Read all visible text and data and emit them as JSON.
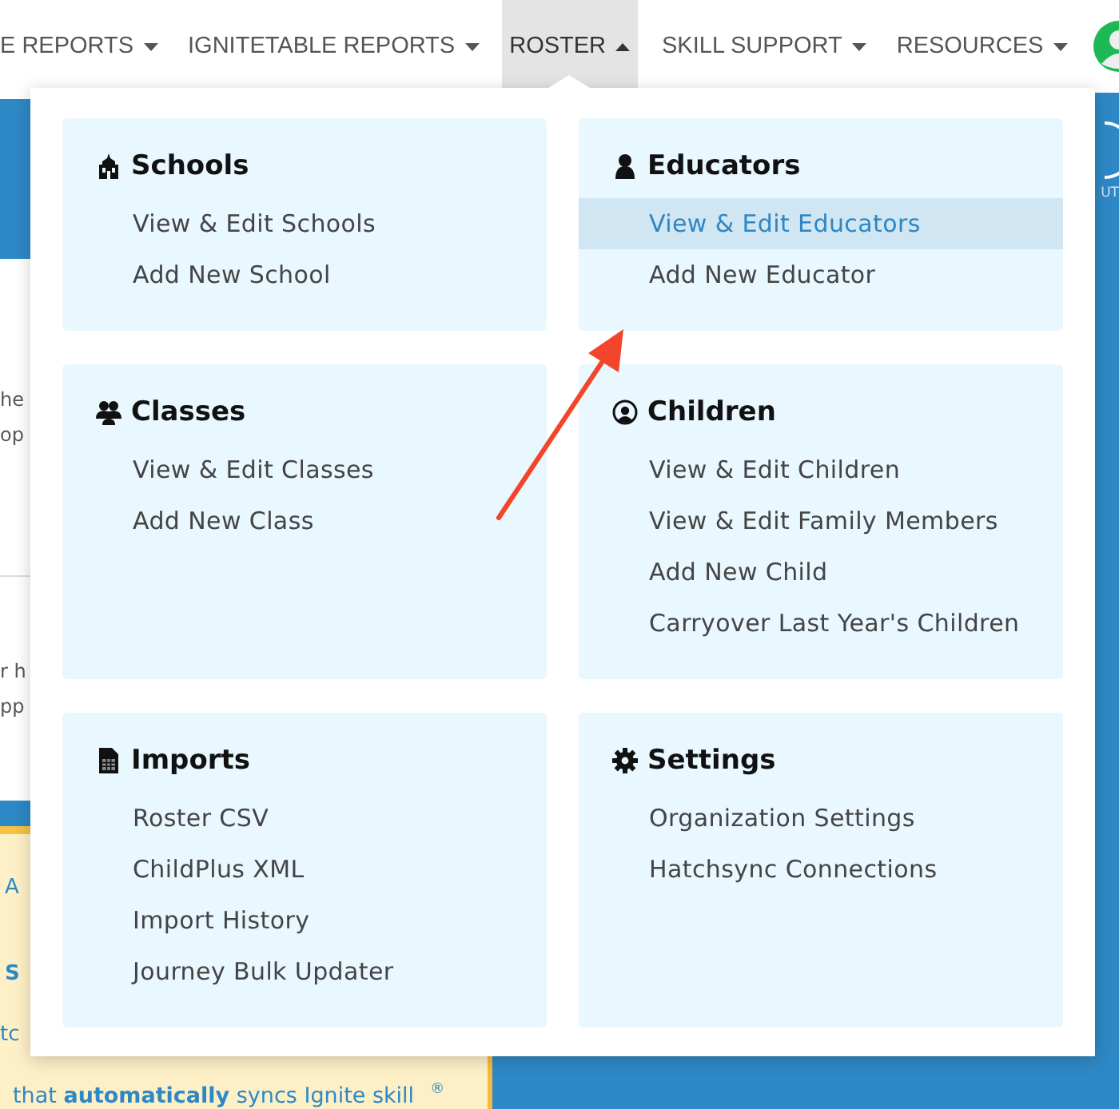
{
  "nav": {
    "items": [
      {
        "label": "E REPORTS",
        "selected": false
      },
      {
        "label": "IGNITETABLE REPORTS",
        "selected": false
      },
      {
        "label": "ROSTER",
        "selected": true
      },
      {
        "label": "SKILL SUPPORT",
        "selected": false
      },
      {
        "label": "RESOURCES",
        "selected": false
      }
    ]
  },
  "page": {
    "upper_fragments": [
      "he",
      "op"
    ],
    "lower_fragments": [
      "r h",
      "pp"
    ],
    "notice_fragments": [
      "A",
      "S",
      "tc"
    ],
    "notice_line": "that **automatically** syncs Ignite skill",
    "notice_mark": "®",
    "side_label": "UT"
  },
  "dropdown": {
    "sections": [
      {
        "title": "Schools",
        "kind": "school",
        "items": [
          {
            "label": "View & Edit Schools",
            "selected": false
          },
          {
            "label": "Add New School",
            "selected": false
          }
        ]
      },
      {
        "title": "Educators",
        "kind": "person",
        "items": [
          {
            "label": "View & Edit Educators",
            "selected": true
          },
          {
            "label": "Add New Educator",
            "selected": false
          }
        ]
      },
      {
        "title": "Classes",
        "kind": "group",
        "items": [
          {
            "label": "View & Edit Classes",
            "selected": false
          },
          {
            "label": "Add New Class",
            "selected": false
          }
        ]
      },
      {
        "title": "Children",
        "kind": "child",
        "items": [
          {
            "label": "View & Edit Children",
            "selected": false
          },
          {
            "label": "View & Edit Family Members",
            "selected": false
          },
          {
            "label": "Add New Child",
            "selected": false
          },
          {
            "label": "Carryover Last Year's Children",
            "selected": false
          }
        ]
      },
      {
        "title": "Imports",
        "kind": "file",
        "items": [
          {
            "label": "Roster CSV",
            "selected": false
          },
          {
            "label": "ChildPlus XML",
            "selected": false
          },
          {
            "label": "Import History",
            "selected": false
          },
          {
            "label": "Journey Bulk Updater",
            "selected": false
          }
        ]
      },
      {
        "title": "Settings",
        "kind": "gear",
        "items": [
          {
            "label": "Organization Settings",
            "selected": false
          },
          {
            "label": "Hatchsync Connections",
            "selected": false
          }
        ]
      }
    ]
  }
}
